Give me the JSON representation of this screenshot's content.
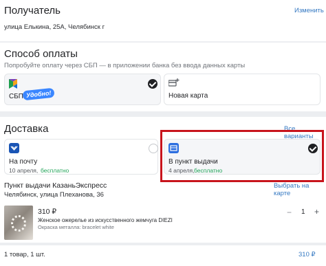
{
  "recipient": {
    "title": "Получатель",
    "change_label": "Изменить",
    "address": "улица Елькина, 25А, Челябинск г"
  },
  "payment": {
    "title": "Способ оплаты",
    "hint": "Попробуйте оплату через СБП — в приложении банка без ввода данных карты",
    "options": [
      {
        "label": "СБП",
        "badge": "Удобно!",
        "selected": true
      },
      {
        "label": "Новая карта",
        "selected": false
      }
    ]
  },
  "delivery": {
    "title": "Доставка",
    "all_options_label": "Все варианты",
    "options": [
      {
        "label": "На почту",
        "date": "10 апреля,",
        "price": "бесплатно",
        "selected": false
      },
      {
        "label": "В пункт выдачи",
        "date": "4 апреля,",
        "price": "бесплатно",
        "selected": true
      }
    ],
    "pickup_point_title": "Пункт выдачи КазаньЭкспресс",
    "pickup_point_address": "Челябинск, улица Плеханова, 36",
    "map_link": "Выбрать на карте"
  },
  "item": {
    "price": "310 ₽",
    "name": "Женское ожерелье из искусственного жемчуга DIEZI",
    "attribute": "Окраска металла: bracelet white",
    "quantity": "1",
    "minus": "−",
    "plus": "+"
  },
  "summary": {
    "count": "1 товар, 1 шт.",
    "total": "310 ₽"
  },
  "colors": {
    "accent_link": "#3478c2",
    "green": "#23a55a",
    "highlight_border": "#c8141c",
    "sbp_badge": "#3a86ff"
  }
}
